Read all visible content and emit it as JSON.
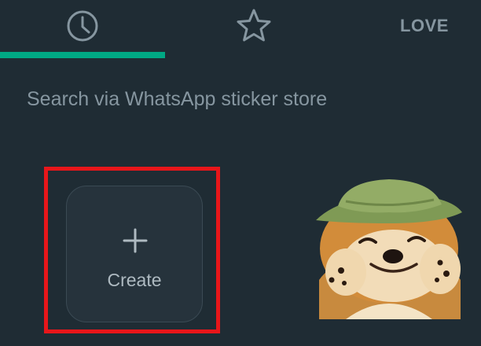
{
  "tabs": {
    "recent": {
      "icon": "clock-icon",
      "selected": true
    },
    "favorites": {
      "icon": "star-icon",
      "selected": false
    },
    "love": {
      "label": "LOVE",
      "selected": false
    }
  },
  "search": {
    "hint": "Search via WhatsApp sticker store"
  },
  "stickers": {
    "create": {
      "label": "Create",
      "icon": "plus-icon"
    },
    "items": [
      {
        "name": "shiba-dog-with-hat-sticker"
      }
    ]
  },
  "colors": {
    "background": "#1f2c34",
    "accent": "#00a884",
    "highlight": "#e8161a"
  }
}
